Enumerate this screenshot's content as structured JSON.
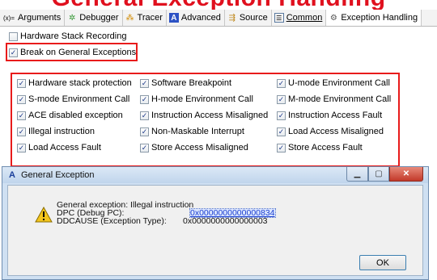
{
  "banner": "General Exception Handling",
  "tabs": [
    {
      "label": "Arguments",
      "icon": "(x)="
    },
    {
      "label": "Debugger",
      "icon": "bug-icon"
    },
    {
      "label": "Tracer",
      "icon": "trace-icon"
    },
    {
      "label": "Advanced",
      "icon": "A"
    },
    {
      "label": "Source",
      "icon": "source-icon"
    },
    {
      "label": "Common",
      "icon": "common-icon"
    },
    {
      "label": "Exception Handling",
      "icon": "gear-icon"
    }
  ],
  "hardware_stack_recording": {
    "label": "Hardware Stack Recording",
    "checked": false
  },
  "break_on_general": {
    "label": "Break on General Exceptions",
    "checked": true
  },
  "exceptions": [
    {
      "label": "Hardware stack protection",
      "checked": true
    },
    {
      "label": "Software Breakpoint",
      "checked": true
    },
    {
      "label": "U-mode Environment Call",
      "checked": true
    },
    {
      "label": "S-mode Environment Call",
      "checked": true
    },
    {
      "label": "H-mode Environment Call",
      "checked": true
    },
    {
      "label": "M-mode Environment Call",
      "checked": true
    },
    {
      "label": "ACE disabled exception",
      "checked": true
    },
    {
      "label": "Instruction Access Misaligned",
      "checked": true
    },
    {
      "label": "Instruction Access Fault",
      "checked": true
    },
    {
      "label": "Illegal instruction",
      "checked": true
    },
    {
      "label": "Non-Maskable Interrupt",
      "checked": true
    },
    {
      "label": "Load Access Misaligned",
      "checked": true
    },
    {
      "label": "Load Access Fault",
      "checked": true
    },
    {
      "label": "Store Access Misaligned",
      "checked": true
    },
    {
      "label": "Store Access Fault",
      "checked": true
    }
  ],
  "dialog": {
    "title": "General Exception",
    "line1": "General exception: Illegal instruction",
    "dpc_label": "DPC (Debug PC):",
    "dpc_value": "0x0000000000000834",
    "ddcause_label": "DDCAUSE (Exception Type):",
    "ddcause_value": "0x0000000000000003",
    "ok_label": "OK"
  },
  "colors": {
    "highlight_border": "#e81b1b",
    "banner_text": "#e0101e"
  }
}
